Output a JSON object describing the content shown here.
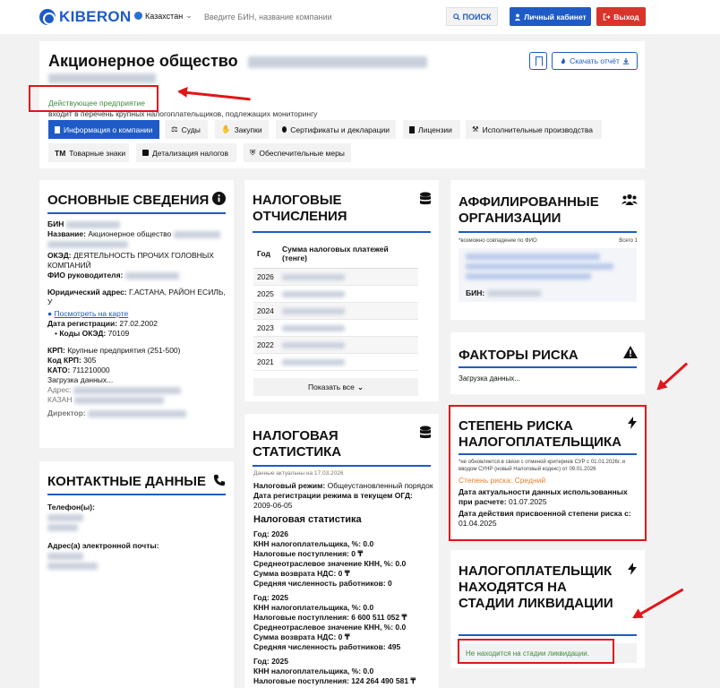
{
  "header": {
    "logo": "KIBERON",
    "region": "Казахстан",
    "search_placeholder": "Введите БИН, название компании",
    "search_button": "ПОИСК",
    "cabinet_button": "Личный кабинет",
    "logout_button": "Выход"
  },
  "company": {
    "title_prefix": "Акционерное общество",
    "status": "Действующее предприятие",
    "monitoring": "входит в перечень крупных налогоплательщиков, подлежащих мониторингу",
    "download_button": "Скачать отчёт",
    "tabs": [
      "Информация о компании",
      "Суды",
      "Закупки",
      "Сертификаты и декларации",
      "Лицензии",
      "Исполнительные производства",
      "Товарные знаки",
      "Детализация налогов",
      "Обеспечительные меры"
    ],
    "tab_tm_prefix": "ТМ"
  },
  "basic": {
    "title": "ОСНОВНЫЕ СВЕДЕНИЯ",
    "bin_label": "БИН",
    "name_label": "Название:",
    "name_value": "Акционерное общество",
    "oked_label": "ОКЭД:",
    "oked_value": "ДЕЯТЕЛЬНОСТЬ ПРОЧИХ ГОЛОВНЫХ КОМПАНИЙ",
    "head_label": "ФИО руководителя:",
    "address_label": "Юридический адрес:",
    "address_value": "Г.АСТАНА, РАЙОН ЕСИЛЬ, У",
    "map_link": "Посмотреть на карте",
    "reg_label": "Дата регистрации:",
    "reg_value": "27.02.2002",
    "codes_label": "Коды ОКЭД:",
    "codes_value": "70109",
    "krp_label": "КРП:",
    "krp_value": "Крупные предприятия (251-500)",
    "krp_code_label": "Код КРП:",
    "krp_code_value": "305",
    "kato_label": "КАТО:",
    "kato_value": "711210000",
    "loading": "Загрузка данных...",
    "address2_label": "Адрес:",
    "address2_value": "КАЗАН",
    "director_label": "Директор:"
  },
  "contacts": {
    "title": "КОНТАКТНЫЕ ДАННЫЕ",
    "phone_label": "Телефон(ы):",
    "email_label": "Адрес(а) электронной почты:"
  },
  "tax": {
    "title": "НАЛОГОВЫЕ ОТЧИСЛЕНИЯ",
    "col_year": "Год",
    "col_sum": "Сумма налоговых платежей (тенге)",
    "years": [
      "2026",
      "2025",
      "2024",
      "2023",
      "2022",
      "2021"
    ],
    "show_all": "Показать все"
  },
  "stats": {
    "title": "НАЛОГОВАЯ СТАТИСТИКА",
    "actual": "Данные актуальны на 17.03.2026",
    "mode_label": "Налоговый режим:",
    "mode_value": "Общеустановленный порядок",
    "date_mode_label": "Дата регистрации режима в текущем ОГД:",
    "date_mode_value": "2009-06-05",
    "subtitle": "Налоговая статистика",
    "blocks": [
      {
        "year": "Год: 2026",
        "knn": "КНН налогоплательщика, %: 0.0",
        "income": "Налоговые поступления: 0 ₸",
        "avg": "Среднеотраслевое значение КНН, %: 0.0",
        "vat": "Сумма возврата НДС: 0 ₸",
        "staff": "Средняя численность работников: 0"
      },
      {
        "year": "Год: 2025",
        "knn": "КНН налогоплательщика, %: 0.0",
        "income": "Налоговые поступления: 6 600 511 052 ₸",
        "avg": "Среднеотраслевое значение КНН, %: 0.0",
        "vat": "Сумма возврата НДС: 0 ₸",
        "staff": "Средняя численность работников: 495"
      },
      {
        "year": "Год: 2025",
        "knn": "КНН налогоплательщика, %: 0.0",
        "income": "Налоговые поступления: 124 264 490 581 ₸"
      }
    ]
  },
  "affiliates": {
    "title": "АФФИЛИРОВАННЫЕ ОРГАНИЗАЦИИ",
    "note": "*возможно совпадение по ФИО",
    "total": "Всего 1",
    "bin_label": "БИН:"
  },
  "risk_factors": {
    "title": "ФАКТОРЫ РИСКА",
    "loading": "Загрузка данных..."
  },
  "risk_degree": {
    "title": "СТЕПЕНЬ РИСКА НАЛОГОПЛАТЕЛЬЩИКА",
    "note": "*не обновляется в связи с отменой критериев СУР с 01.01.2026г. и вводом СУНР (новый Налоговый кодекс) от 09.01.2026",
    "level_label": "Степень риска:",
    "level_value": "Средний",
    "actual_label": "Дата актуальности данных использованных при расчете:",
    "actual_value": "01.07.2025",
    "valid_label": "Дата действия присвоенной степени риска с:",
    "valid_value": "01.04.2025"
  },
  "liquidation": {
    "title": "НАЛОГОПЛАТЕЛЬЩИК НАХОДЯТСЯ НА СТАДИИ ЛИКВИДАЦИИ",
    "status": "Не находится на стадии ликвидации."
  },
  "colors": {
    "brand": "#1e5bc6",
    "danger": "#d9342b",
    "annotation": "#e0161b",
    "status_green": "#3c8f3c",
    "risk_orange": "#e8822d"
  }
}
